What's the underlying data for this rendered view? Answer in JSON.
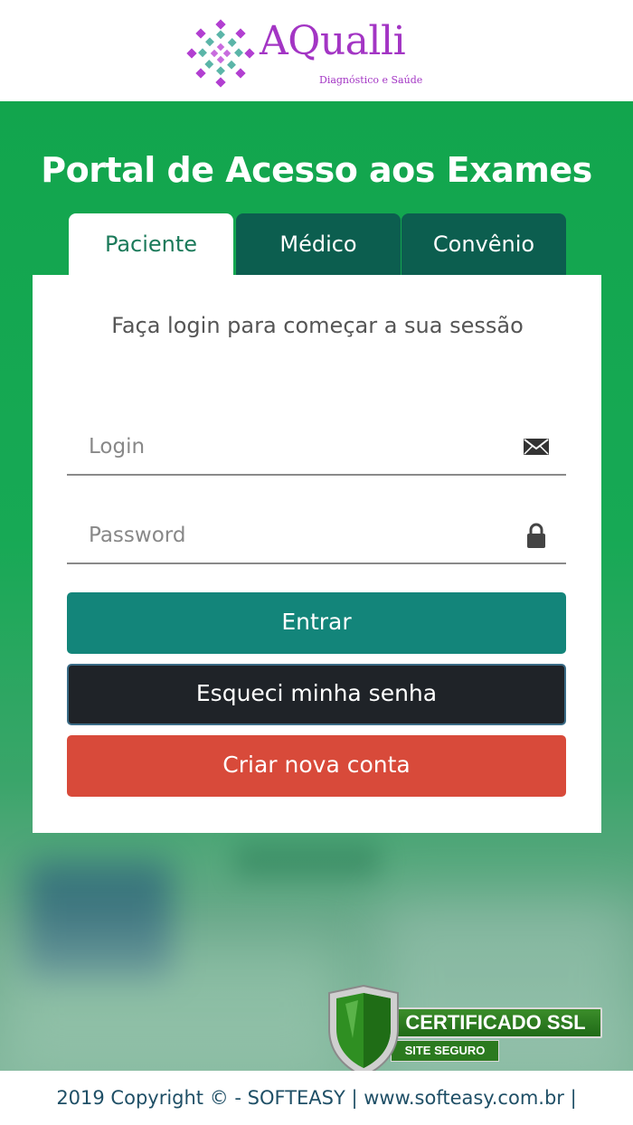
{
  "brand": {
    "name": "AQualli",
    "tagline": "Diagnóstico e Saúde",
    "color": "#a335c4"
  },
  "page": {
    "title": "Portal de Acesso aos Exames"
  },
  "tabs": [
    {
      "label": "Paciente",
      "active": true
    },
    {
      "label": "Médico",
      "active": false
    },
    {
      "label": "Convênio",
      "active": false
    }
  ],
  "form": {
    "message": "Faça login para começar a sua sessão",
    "login_placeholder": "Login",
    "login_icon": "envelope-icon",
    "password_placeholder": "Password",
    "password_icon": "lock-icon",
    "login_value": "",
    "password_value": ""
  },
  "buttons": {
    "entrar": "Entrar",
    "esqueci": "Esqueci minha senha",
    "criar": "Criar nova conta"
  },
  "colors": {
    "background_green": "#17a955",
    "tab_inactive": "#0c5e4f",
    "entrar": "#13857a",
    "esqueci": "#1f2328",
    "criar": "#d84a3a"
  },
  "ssl_badge": {
    "title": "CERTIFICADO SSL",
    "subtitle": "SITE SEGURO"
  },
  "footer": {
    "text": "2019 Copyright © - SOFTEASY | www.softeasy.com.br |"
  }
}
